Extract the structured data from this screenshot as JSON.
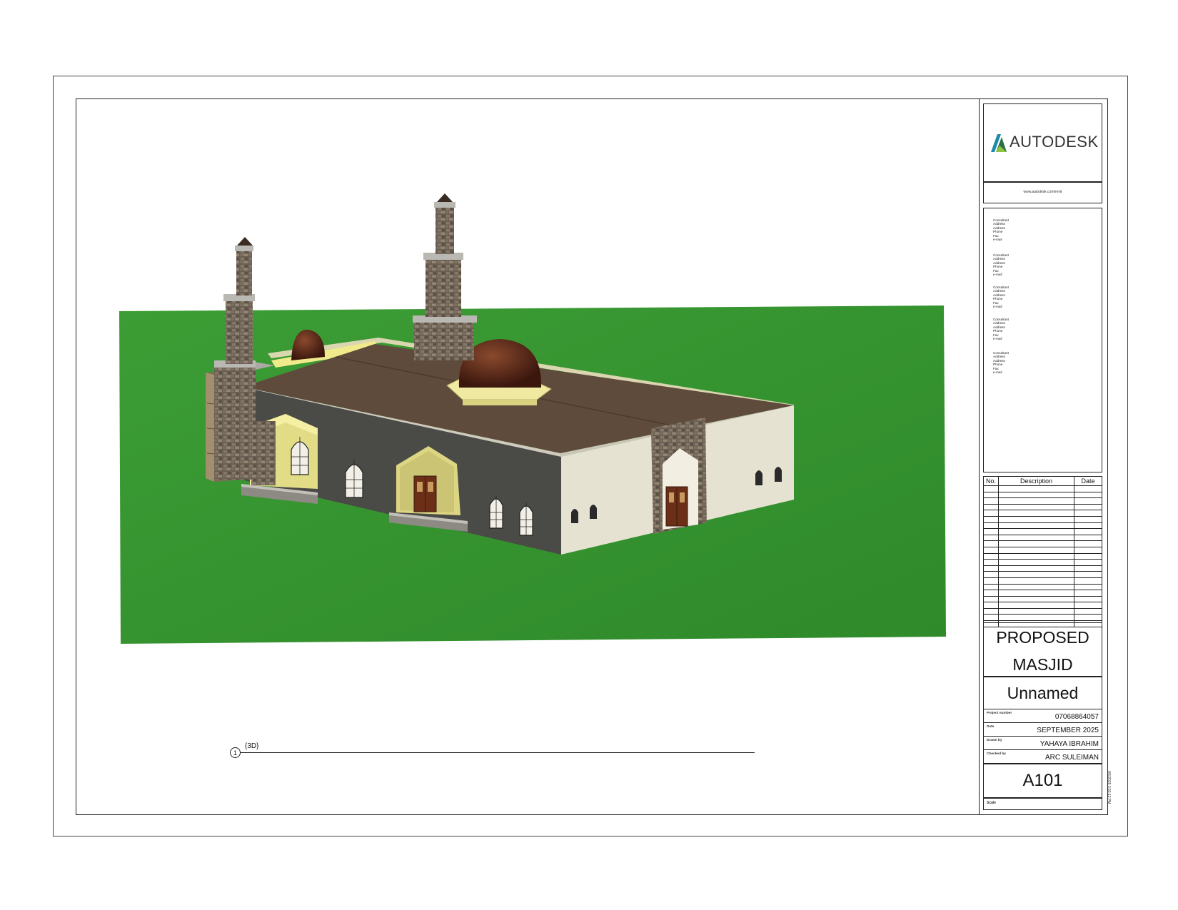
{
  "title_block": {
    "logo": "AUTODESK",
    "url": "www.autodesk.com/revit",
    "consultants": [
      [
        "Consultant",
        "Address",
        "Address",
        "Phone",
        "Fax",
        "e-mail"
      ],
      [
        "Consultant",
        "Address",
        "Address",
        "Phone",
        "Fax",
        "e-mail"
      ],
      [
        "Consultant",
        "Address",
        "Address",
        "Phone",
        "Fax",
        "e-mail"
      ],
      [
        "Consultant",
        "Address",
        "Address",
        "Phone",
        "Fax",
        "e-mail"
      ],
      [
        "Consultant",
        "Address",
        "Address",
        "Phone",
        "Fax",
        "e-mail"
      ]
    ],
    "revision_headers": {
      "no": "No.",
      "description": "Description",
      "date": "Date"
    },
    "project_name_line1": "PROPOSED",
    "project_name_line2": "MASJID",
    "sheet_name": "Unnamed",
    "info": [
      {
        "label": "Project number",
        "value": "07068864057"
      },
      {
        "label": "Date",
        "value": "SEPTEMBER 2025"
      },
      {
        "label": "Drawn by",
        "value": "YAHAYA IBRAHIM"
      },
      {
        "label": "Checked by",
        "value": "ARC SULEIMAN"
      }
    ],
    "sheet_number": "A101",
    "scale_label": "Scale",
    "print_date": "9/5/2025 3:53:12 PM"
  },
  "view": {
    "number": "1",
    "name": "{3D}"
  },
  "colors": {
    "grass": "#3a9a33",
    "roof": "#5e4b3c",
    "dome": "#4a1e12",
    "front_wall": "#4a4a47",
    "side_wall": "#e6e2d2",
    "stone": "#6e6356",
    "accent_yellow": "#e6e08a"
  }
}
